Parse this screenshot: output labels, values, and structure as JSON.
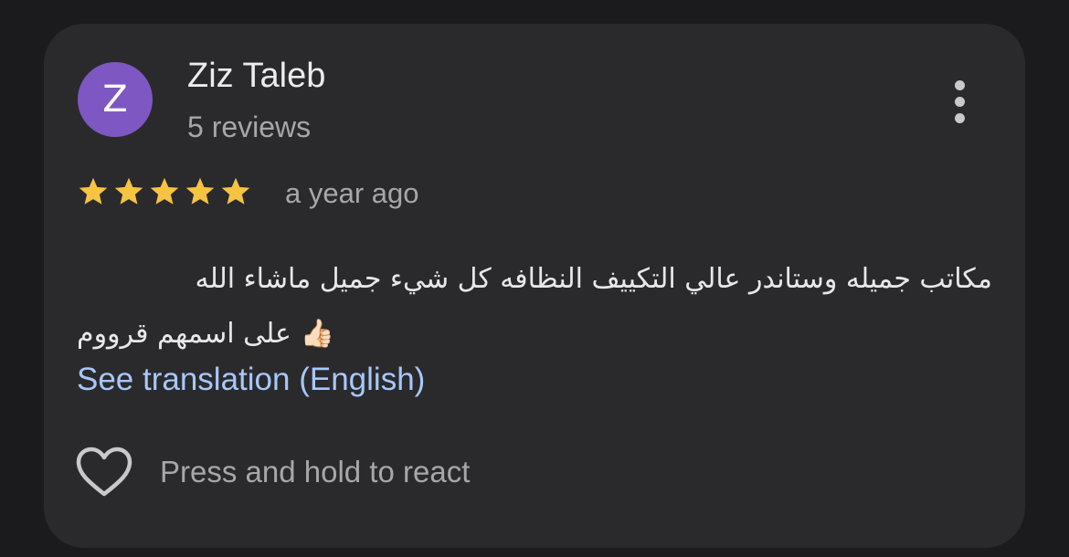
{
  "review": {
    "author": {
      "initial": "Z",
      "name": "Ziz Taleb",
      "reviews_count": "5 reviews",
      "avatar_color": "#7e57c2"
    },
    "more_icon": "more-vertical-icon",
    "rating": 5,
    "rating_max": 5,
    "star_color": "#f6c342",
    "time": "a year ago",
    "text_line1": "مكاتب جميله وستاندر عالي التكييف النظافه كل شيء جميل ماشاء الله",
    "text_line2": "على اسمهم قرووم",
    "emoji": "👍🏻",
    "translation_link": "See translation (English)",
    "react_icon": "heart-outline-icon",
    "react_label": "Press and hold to react"
  }
}
